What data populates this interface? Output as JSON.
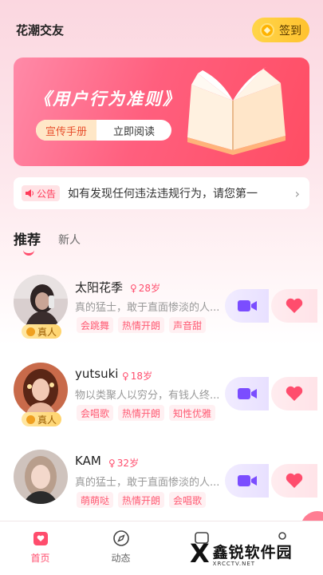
{
  "header": {
    "title": "花潮交友",
    "signin_label": "签到"
  },
  "banner": {
    "title": "《用户行为准则》",
    "tag": "宣传手册",
    "action": "立即阅读"
  },
  "notice": {
    "tag": "公告",
    "text": "如有发现任何违法违规行为，请您第一"
  },
  "tabs": [
    {
      "label": "推荐"
    },
    {
      "label": "新人"
    }
  ],
  "users": [
    {
      "name": "太阳花季",
      "age": "28岁",
      "bio": "真的猛士，敢于直面惨淡的人...",
      "real": "真人",
      "tags": [
        "会跳舞",
        "热情开朗",
        "声音甜"
      ]
    },
    {
      "name": "yutsuki",
      "age": "18岁",
      "bio": "物以类聚人以穷分，有钱人终...",
      "real": "真人",
      "tags": [
        "会唱歌",
        "热情开朗",
        "知性优雅"
      ]
    },
    {
      "name": "KAM",
      "age": "32岁",
      "bio": "真的猛士，敢于直面惨淡的人...",
      "real": "",
      "tags": [
        "萌萌哒",
        "热情开朗",
        "会唱歌"
      ]
    }
  ],
  "bottom_nav": [
    {
      "label": "首页"
    },
    {
      "label": "动态"
    },
    {
      "label": ""
    },
    {
      "label": ""
    }
  ],
  "watermark": {
    "mark": "X",
    "name": "鑫锐软件园",
    "url": "XRCCTV.NET"
  },
  "colors": {
    "accent": "#ff4d6d",
    "video": "#7b4dff",
    "gold": "#ffc22e"
  }
}
